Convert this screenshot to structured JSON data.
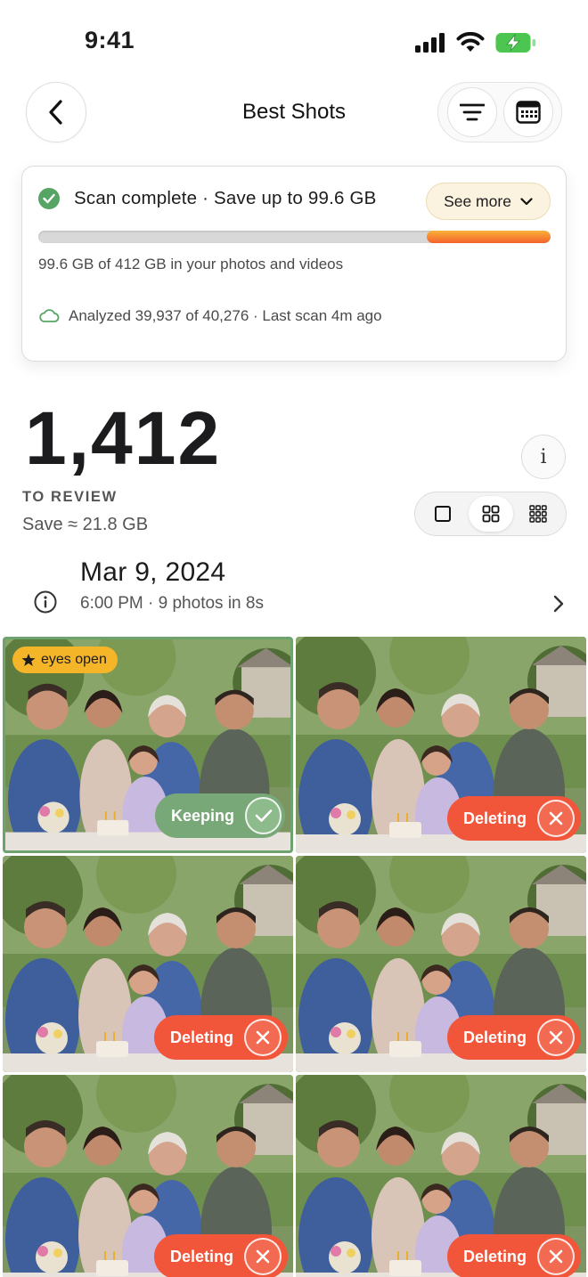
{
  "status_bar": {
    "time": "9:41"
  },
  "nav": {
    "title": "Best Shots"
  },
  "scan_card": {
    "title": "Scan complete · Save up to 99.6 GB",
    "see_more_label": "See more",
    "progress_fraction": 0.242,
    "usage_text": "99.6 GB of 412 GB in your photos and videos",
    "analyzed_text": "Analyzed 39,937 of 40,276 · Last scan 4m ago"
  },
  "review": {
    "count": "1,412",
    "label": "TO REVIEW",
    "save_text": "Save ≈ 21.8 GB"
  },
  "group": {
    "date": "Mar 9, 2024",
    "meta": "6:00 PM · 9 photos in 8s"
  },
  "photos": [
    {
      "status": "Keeping",
      "tag": "eyes open"
    },
    {
      "status": "Deleting"
    },
    {
      "status": "Deleting"
    },
    {
      "status": "Deleting"
    },
    {
      "status": "Deleting"
    },
    {
      "status": "Deleting"
    }
  ],
  "colors": {
    "keep_green": "#78a877",
    "delete_red": "#f1553a",
    "tag_yellow": "#f5b529",
    "check_green": "#56a565",
    "progress_orange": "#f3622c"
  },
  "icons": {
    "back": "chevron-left-icon",
    "filter": "filter-lines-icon",
    "calendar": "calendar-icon",
    "info": "info-icon",
    "cloud": "cloud-icon",
    "chevron": "chevron-right-icon"
  }
}
